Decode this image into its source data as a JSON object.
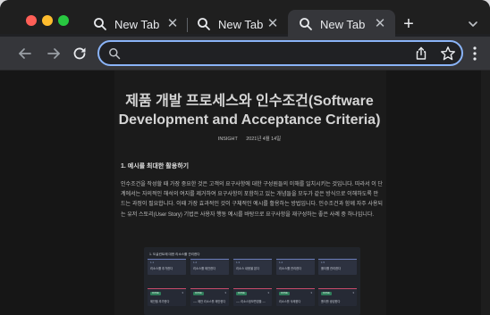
{
  "browser": {
    "tabs": [
      {
        "label": "New Tab"
      },
      {
        "label": "New Tab"
      },
      {
        "label": "New Tab",
        "active": true
      }
    ],
    "new_tab_label": "+",
    "close_glyph": "✕",
    "address_bar": {
      "value": "",
      "placeholder": ""
    },
    "accent_color": "#8ab4f8"
  },
  "article": {
    "title": "제품 개발 프로세스와 인수조건(Software Development and Acceptance Criteria)",
    "category": "INSIGHT",
    "date": "2021년 4월 14일",
    "section_heading": "1. 예시를 최대한 활용하기",
    "paragraph": "인수조건을 작성할 때 가장 중요한 것은 고객의 요구사항에 대한 구성원들의 이해를 일치시키는 것입니다. 따라서 이 단계에서는 자의적인 해석의 여지를 제거하여 요구사항이 포함하고 있는 개념들을 모두가 같은 방식으로 이해하도록 만드는 과정이 필요합니다. 이때 가장 효과적인 것이 구체적인 예시를 활용하는 방법입니다. 인수조건과 함께 자주 사용되는 유저 스토리(User Story) 기법은 사용자 행동 예시를 바탕으로 요구사항을 재구성하는 좋은 사례 중 하나입니다."
  },
  "diagram": {
    "title": "1. 도글컨트에 대한 리소스를 관리한다",
    "row1": [
      {
        "tag": "1.1",
        "text": "리소스를 추가한다"
      },
      {
        "tag": "1.2",
        "text": "리소스를 제안한다"
      },
      {
        "tag": "1.3",
        "text": "리소스 내용을 본다"
      },
      {
        "tag": "1.4",
        "text": "리소스를 관리한다"
      },
      {
        "tag": "1.5",
        "text": "폴더를 관리한다"
      }
    ],
    "row2": [
      {
        "badge": "DONE",
        "num": "3",
        "text": "제안을 추가한다"
      },
      {
        "badge": "DONE",
        "num": "3",
        "text": "---- 제안 리소스를 제안한다"
      },
      {
        "badge": "DONE",
        "num": "3",
        "text": "---- 리소스정보변경을 ---"
      },
      {
        "badge": "DONE",
        "num": "3",
        "text": "리소스를 삭제한다"
      },
      {
        "badge": "DONE",
        "num": "3",
        "text": "폴더를 생성한다"
      }
    ]
  }
}
